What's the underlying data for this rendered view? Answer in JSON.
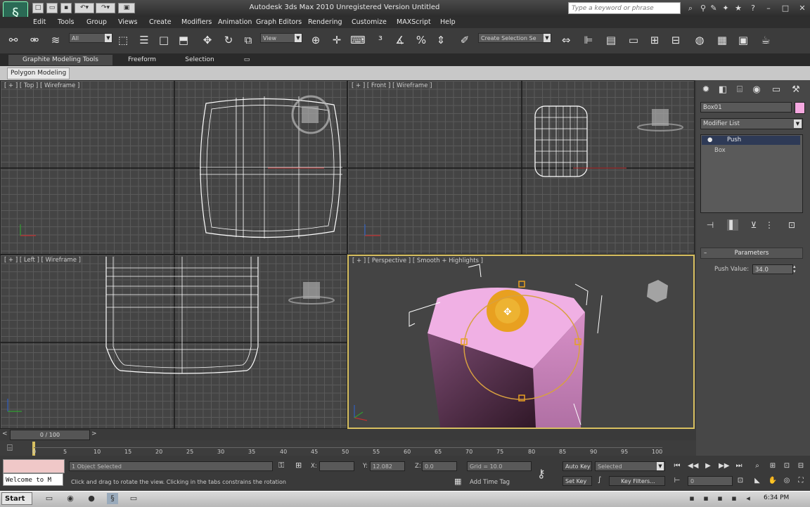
{
  "window": {
    "title": "Autodesk 3ds Max  2010     Unregistered Version     Untitled",
    "search_placeholder": "Type a keyword or phrase",
    "logo_glyph": "§"
  },
  "menu": [
    "Edit",
    "Tools",
    "Group",
    "Views",
    "Create",
    "Modifiers",
    "Animation",
    "Graph Editors",
    "Rendering",
    "Customize",
    "MAXScript",
    "Help"
  ],
  "toolbar": {
    "selection_filter": "All",
    "coord_system": "View",
    "named_selection": "Create Selection Se"
  },
  "ribbon": {
    "tabs": [
      "Graphite Modeling Tools",
      "Freeform",
      "Selection"
    ],
    "panel_label": "Polygon Modeling"
  },
  "viewports": {
    "top": "[ + ] [ Top ] [ Wireframe ]",
    "front": "[ + ] [ Front ] [ Wireframe ]",
    "left": "[ + ] [ Left ] [ Wireframe ]",
    "perspective": "[ + ] [ Perspective ] [ Smooth + Highlights ]"
  },
  "command_panel": {
    "object_name": "Box01",
    "object_color": "#f5a8e0",
    "modifier_list": "Modifier List",
    "stack": [
      "Push",
      "Box"
    ],
    "rollout_title": "Parameters",
    "push_label": "Push Value:",
    "push_value": "34.0"
  },
  "timeline": {
    "slider": "0 / 100",
    "ticks": [
      "0",
      "5",
      "10",
      "15",
      "20",
      "25",
      "30",
      "35",
      "40",
      "45",
      "50",
      "55",
      "60",
      "65",
      "70",
      "75",
      "80",
      "85",
      "90",
      "95",
      "100"
    ]
  },
  "status": {
    "maxscript_text": "Welcome to M",
    "selection": "1 Object Selected",
    "prompt": "Click and drag to rotate the view.  Clicking in the tabs constrains the rotation",
    "x_label": "X:",
    "y_label": "Y:",
    "y_value": "12.082",
    "z_label": "Z:",
    "z_value": "0.0",
    "grid": "Grid = 10.0",
    "add_time_tag": "Add Time Tag",
    "auto_key": "Auto Key",
    "set_key": "Set Key",
    "key_mode": "Selected",
    "key_filters": "Key Filters...",
    "frame": "0"
  },
  "taskbar": {
    "start": "Start",
    "clock": "6:34 PM"
  },
  "colors": {
    "accent_viewport_border": "#d8c060",
    "box_pink": "#f5a8e0",
    "gizmo_orange": "#e8a020"
  }
}
